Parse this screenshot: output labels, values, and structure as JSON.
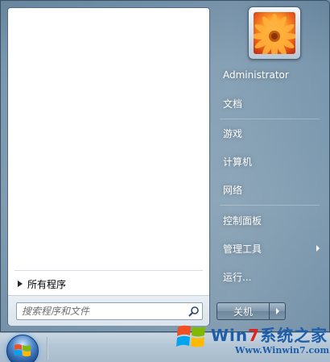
{
  "start_menu": {
    "all_programs": "所有程序",
    "search": {
      "placeholder": "搜索程序和文件"
    },
    "right_items": [
      {
        "label": "Administrator"
      },
      {
        "label": "文档"
      },
      {
        "label": "游戏"
      },
      {
        "label": "计算机"
      },
      {
        "label": "网络"
      },
      {
        "label": "控制面板"
      },
      {
        "label": "管理工具",
        "has_submenu": true
      },
      {
        "label": "运行..."
      }
    ],
    "shutdown_label": "关机"
  },
  "watermark": {
    "brand_prefix": "Win",
    "brand_seven": "7",
    "brand_suffix": "系统之家",
    "url": "Www.Winwin7.com"
  },
  "icons": {
    "search": "search-icon",
    "start_orb": "windows-logo-icon",
    "avatar": "flower-avatar-icon"
  }
}
